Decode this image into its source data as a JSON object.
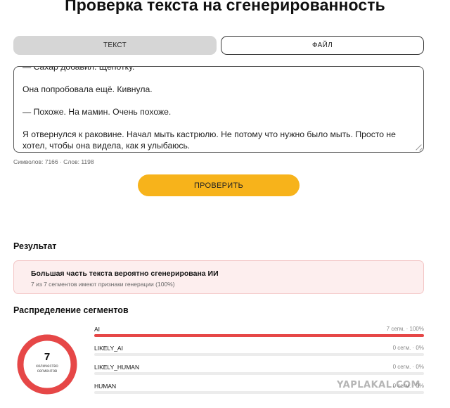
{
  "page": {
    "title": "Проверка текста на сгенерированность"
  },
  "tabs": [
    {
      "label": "ТЕКСТ",
      "active": true
    },
    {
      "label": "ФАЙЛ",
      "active": false
    }
  ],
  "textbox": {
    "paragraphs": [
      "— Сахар добавил. Щепотку.",
      "Она попробовала ещё. Кивнула.",
      "— Похоже. На мамин. Очень похоже.",
      "Я отвернулся к раковине. Начал мыть кастрюлю. Не потому что нужно было мыть. Просто не хотел, чтобы она видела, как я улыбаюсь."
    ]
  },
  "counter": "Символов: 7166 · Слов: 1198",
  "check_button": "ПРОВЕРИТЬ",
  "result": {
    "heading": "Результат",
    "title": "Большая часть текста вероятно сгенерирована ИИ",
    "subtitle": "7 из 7 сегментов имеют признаки генерации (100%)"
  },
  "distribution": {
    "heading": "Распределение сегментов",
    "total": "7",
    "caption": "количество сегментов",
    "segments": [
      {
        "label": "AI",
        "value": "7 сегм. · 100%",
        "fraction": 1.0,
        "color": "#e64747"
      },
      {
        "label": "LIKELY_AI",
        "value": "0 сегм. · 0%",
        "fraction": 0,
        "color": "#f08a5d"
      },
      {
        "label": "LIKELY_HUMAN",
        "value": "0 сегм. · 0%",
        "fraction": 0,
        "color": "#7cc47c"
      },
      {
        "label": "HUMAN",
        "value": "0 сегм. · 0%",
        "fraction": 0,
        "color": "#3aa04a"
      }
    ]
  },
  "watermark": "YAPLAKAL.COM"
}
